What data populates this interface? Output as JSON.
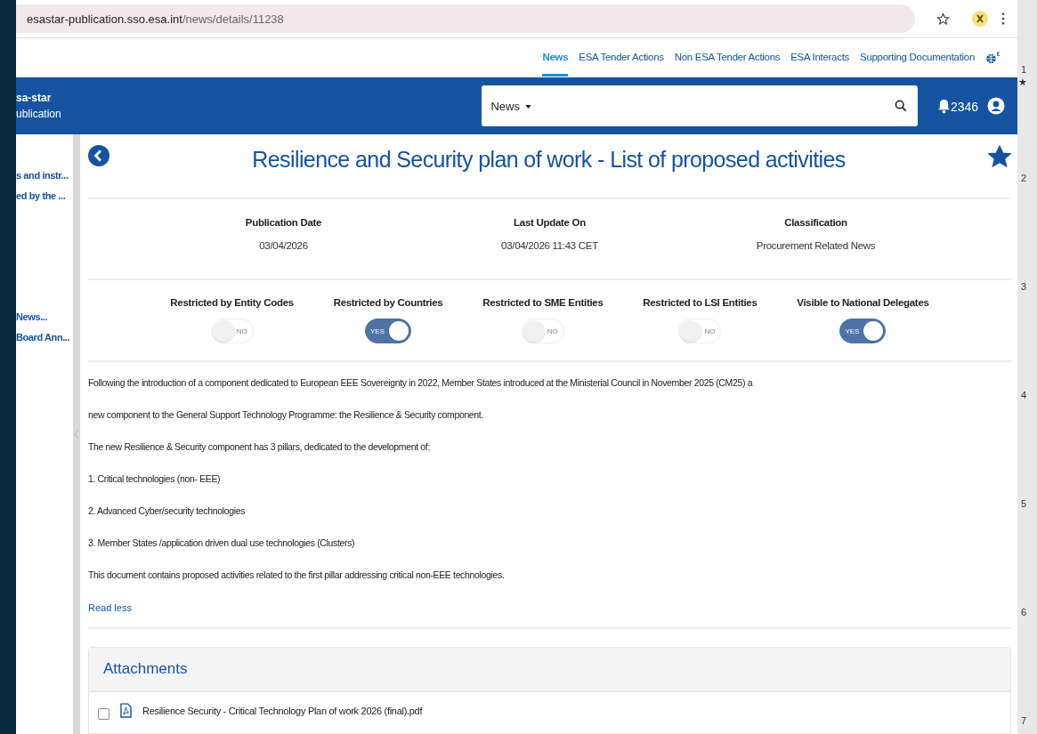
{
  "browser": {
    "url_host": "esastar-publication.sso.esa.int",
    "url_path": "/news/details/11238"
  },
  "top_nav": [
    {
      "label": "News",
      "selected": true
    },
    {
      "label": "ESA Tender Actions",
      "selected": false
    },
    {
      "label": "Non ESA Tender Actions",
      "selected": false
    },
    {
      "label": "ESA Interacts",
      "selected": false
    },
    {
      "label": "Supporting Documentation",
      "selected": false
    }
  ],
  "header": {
    "logo_lines": [
      "sa-star",
      "ublication"
    ],
    "search_scope": "News",
    "notifications": "2346"
  },
  "sidebar": {
    "groups": [
      [
        "s and instr...",
        "ed by the ..."
      ],
      [
        "News...",
        "Board Ann..."
      ]
    ]
  },
  "page": {
    "title": "Resilience and Security plan of work - List of proposed activities",
    "favorite": true,
    "meta": [
      {
        "label": "Publication Date",
        "value": "03/04/2026"
      },
      {
        "label": "Last Update On",
        "value": "03/04/2026 11:43 CET"
      },
      {
        "label": "Classification",
        "value": "Procurement Related News"
      }
    ],
    "flags": [
      {
        "label": "Restricted by Entity Codes",
        "on": false,
        "text": "NO"
      },
      {
        "label": "Restricted by Countries",
        "on": true,
        "text": "YES"
      },
      {
        "label": "Restricted to SME Entities",
        "on": false,
        "text": "NO"
      },
      {
        "label": "Restricted to LSI Entities",
        "on": false,
        "text": "NO"
      },
      {
        "label": "Visible to National Delegates",
        "on": true,
        "text": "YES"
      }
    ],
    "body": [
      "Following the introduction of a component dedicated to European EEE Sovereignty in 2022, Member States introduced at the Ministerial Council in November 2025 (CM25) a",
      "new component to the General Support Technology Programme: the Resilience & Security component.",
      "The new Resilience & Security component has 3 pillars, dedicated to the development of:",
      "1. Critical technologies (non- EEE)",
      "2. Advanced Cyber/security technologies",
      "3. Member States /application driven dual use technologies (Clusters)",
      "This document contains proposed activities related to the first pillar addressing critical non-EEE technologies."
    ],
    "read_less": "Read less",
    "attachments": {
      "title": "Attachments",
      "files": [
        {
          "name": "Resilience Security - Critical Technology Plan of work 2026 (final).pdf",
          "checked": false
        }
      ]
    }
  },
  "side_strip": {
    "numbers": [
      "1",
      "2",
      "3",
      "4",
      "5",
      "6",
      "7"
    ],
    "marker": "★"
  }
}
